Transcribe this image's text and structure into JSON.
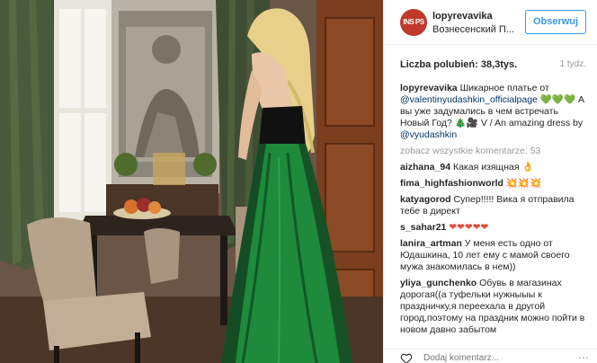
{
  "header": {
    "avatar_text": "INS PS",
    "username": "lopyrevavika",
    "location": "Вознесенский П...",
    "follow_label": "Obserwuj"
  },
  "stats": {
    "likes_label": "Liczba polubień:",
    "likes_value": "38,3tys.",
    "time_ago": "1 tydz."
  },
  "caption": {
    "username": "lopyrevavika",
    "text_1": "Шикарное платье от",
    "mention_1": "@valentinyudashkin_officialpage",
    "text_2": "А вы уже задумались в чем встречать Новый Год?",
    "text_3": "V / An amazing dress by",
    "mention_2": "@vyudashkin"
  },
  "more_comments": "zobacz wszystkie komentarze: 53",
  "comments": [
    {
      "username": "aizhana_94",
      "text": "Какая изящная"
    },
    {
      "username": "fima_highfashionworld",
      "text": "💥💥💥"
    },
    {
      "username": "katyagorod",
      "text": "Супер!!!!! Вика я отправила тебе в директ"
    },
    {
      "username": "s_sahar21",
      "text": "❤❤❤❤❤"
    },
    {
      "username": "lanira_artman",
      "text": "У меня есть одно от Юдашкина, 10 лет ему с мамой своего мужа знакомилась в нем))"
    },
    {
      "username": "yliya_gunchenko",
      "text": "Обувь в магазинах дорогая((а туфельки нужныыы к праздничку,я переехала в другой город,поэтому на праздник можно пойти в новом давно забытом"
    }
  ],
  "footer": {
    "add_comment_placeholder": "Dodaj komentarz...",
    "more_icon": "⋯"
  },
  "colors": {
    "accent": "#3897f0",
    "dress_green": "#1e8a3c",
    "heart": "#e74c3c"
  }
}
